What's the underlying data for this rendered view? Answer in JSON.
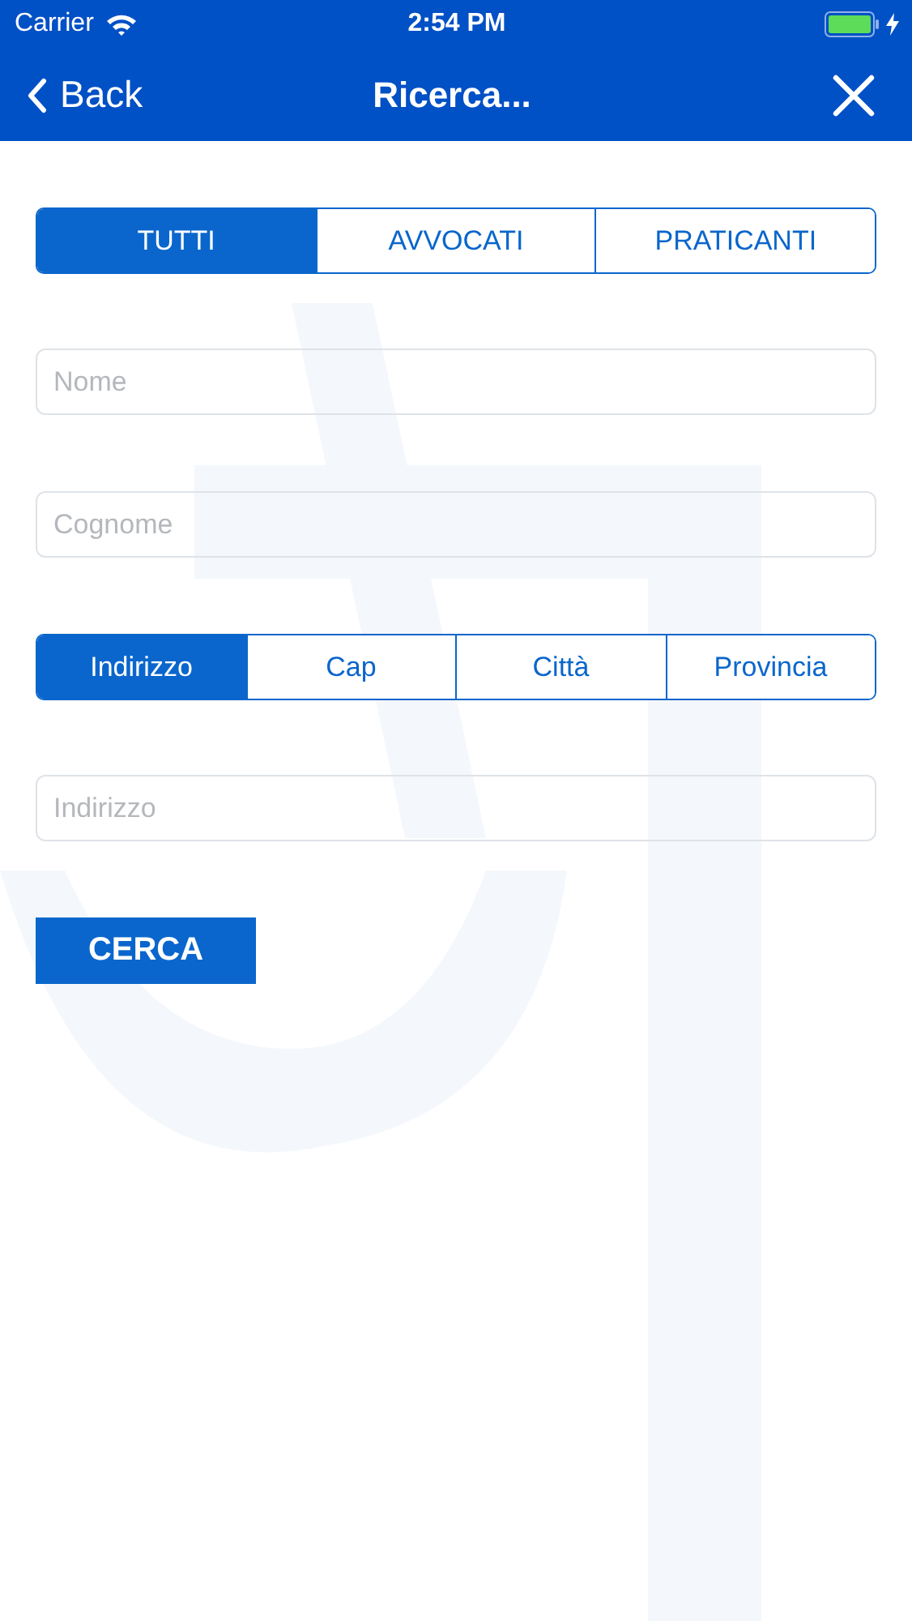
{
  "status_bar": {
    "carrier": "Carrier",
    "time": "2:54 PM"
  },
  "nav_bar": {
    "back": "Back",
    "title": "Ricerca..."
  },
  "category_tabs": [
    {
      "label": "TUTTI",
      "selected": true
    },
    {
      "label": "AVVOCATI",
      "selected": false
    },
    {
      "label": "PRATICANTI",
      "selected": false
    }
  ],
  "fields": [
    {
      "placeholder": "Nome"
    },
    {
      "placeholder": "Cognome"
    }
  ],
  "location_tabs": [
    {
      "label": "Indirizzo",
      "selected": true
    },
    {
      "label": "Cap",
      "selected": false
    },
    {
      "label": "Città",
      "selected": false
    },
    {
      "label": "Provincia",
      "selected": false
    }
  ],
  "location_field": {
    "placeholder": "Indirizzo"
  },
  "search_button": "CERCA"
}
